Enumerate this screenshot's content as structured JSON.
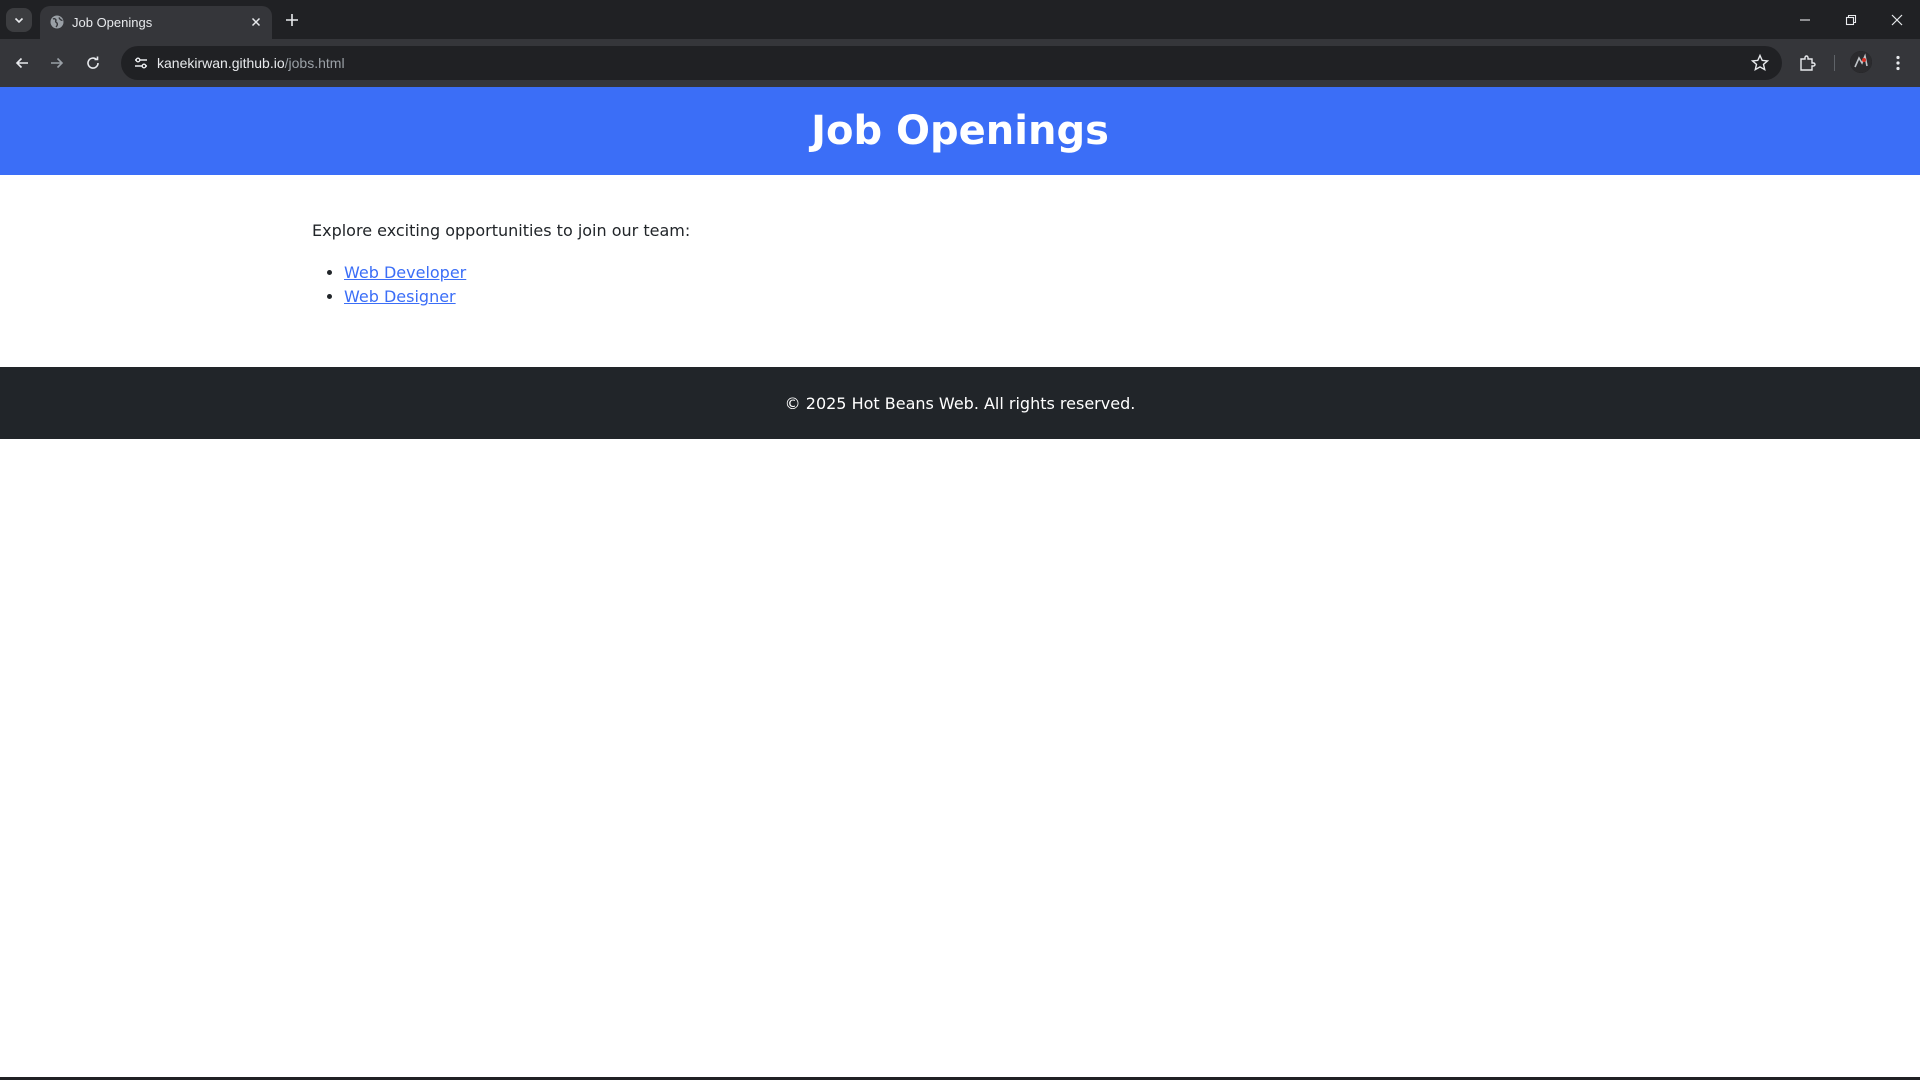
{
  "browser": {
    "tab": {
      "title": "Job Openings",
      "favicon_icon": "globe-icon",
      "close_icon": "close-icon"
    },
    "new_tab_icon": "plus-icon",
    "tab_search_icon": "chevron-down-icon",
    "window_controls": [
      "minimize-icon",
      "restore-icon",
      "close-icon"
    ],
    "nav": [
      "back-arrow-icon",
      "forward-arrow-icon",
      "reload-icon"
    ],
    "address_bar": {
      "host": "kanekirwan.github.io",
      "path": "/jobs.html",
      "site_info_icon": "tune-icon",
      "bookmark_icon": "star-icon"
    },
    "extensions_icon": "puzzle-icon",
    "menu_icon": "kebab-menu-icon"
  },
  "page": {
    "header": {
      "title": "Job Openings"
    },
    "intro": "Explore exciting opportunities to join our team:",
    "jobs": [
      {
        "label": "Web Developer"
      },
      {
        "label": "Web Designer"
      }
    ],
    "footer": {
      "text": "© 2025 Hot Beans Web. All rights reserved."
    }
  },
  "colors": {
    "header_bg": "#3b6ef7",
    "footer_bg": "#212529",
    "link": "#3b6ef7",
    "chrome_dark": "#202124",
    "chrome_toolbar": "#35363a"
  }
}
